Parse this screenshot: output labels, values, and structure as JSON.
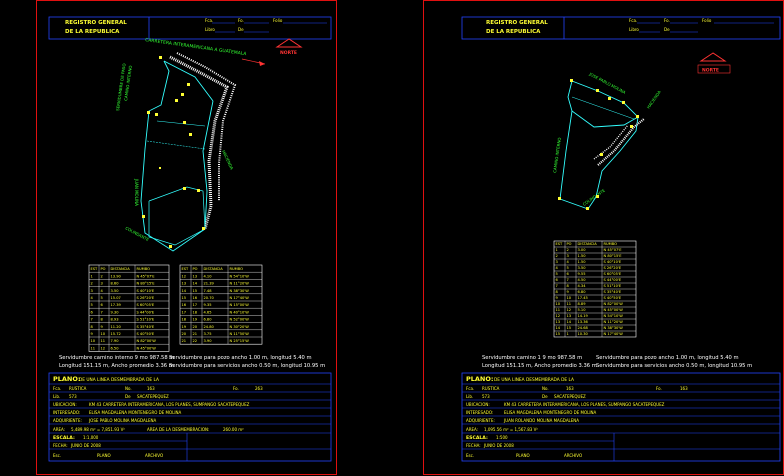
{
  "colors": {
    "background": "#000000",
    "border": "#e01010",
    "text": "#ffff33",
    "line": "#33ffff",
    "label": "#33ff33",
    "blue": "#2244ff",
    "white": "#ffffff"
  },
  "sheets": [
    {
      "header": {
        "title_line1": "REGISTRO GENERAL",
        "title_line2": "DE LA REPUBLICA",
        "finca_label": "Fca.",
        "folio_label": "Fo.",
        "libro_label": "Folio",
        "libro2_label": "Libro",
        "de_label": "De"
      },
      "north_label": "NORTE",
      "road_labels": [
        "CARRETERA INTERAMERICANA A GUATEMALA",
        "SERVIDUMBRE DE PASO",
        "CAMINO INTERNO",
        "JUAN MOLINA",
        "HACIENDA",
        "COLINDANTE"
      ],
      "table1": {
        "headers": [
          "EST",
          "PO",
          "DISTANCIA",
          "RUMBO"
        ],
        "rows": [
          [
            "1",
            "2",
            "13.90",
            "N 45°07'E"
          ],
          [
            "2",
            "3",
            "8.60",
            "N 80°15'E"
          ],
          [
            "3",
            "4",
            "3.50",
            "S 40°10'E"
          ],
          [
            "4",
            "5",
            "15.07",
            "S 26°20'E"
          ],
          [
            "5",
            "6",
            "17.39",
            "S 60°05'E"
          ],
          [
            "6",
            "7",
            "9.30",
            "S 44°00'E"
          ],
          [
            "7",
            "8",
            "8.93",
            "S 51°10'E"
          ],
          [
            "8",
            "9",
            "11.20",
            "S 35°40'E"
          ],
          [
            "9",
            "10",
            "15.72",
            "S 40°50'E"
          ],
          [
            "10",
            "11",
            "7.90",
            "N 82°00'W"
          ],
          [
            "11",
            "12",
            "6.50",
            "N 45°00'W"
          ]
        ]
      },
      "table2": {
        "headers": [
          "EST",
          "PO",
          "DISTANCIA",
          "RUMBO"
        ],
        "rows": [
          [
            "12",
            "13",
            "4.10",
            "N 54°10'W"
          ],
          [
            "13",
            "14",
            "21.39",
            "N 11°20'W"
          ],
          [
            "14",
            "15",
            "7.48",
            "N 38°30'W"
          ],
          [
            "15",
            "16",
            "20.70",
            "N 17°40'W"
          ],
          [
            "16",
            "17",
            "9.35",
            "N 15°00'W"
          ],
          [
            "17",
            "18",
            "4.65",
            "N 40°10'W"
          ],
          [
            "18",
            "19",
            "6.80",
            "N 52°00'W"
          ],
          [
            "19",
            "20",
            "24.80",
            "N 30°20'W"
          ],
          [
            "20",
            "21",
            "3.75",
            "N 11°50'W"
          ],
          [
            "21",
            "22",
            "3.90",
            "N 25°15'W"
          ]
        ]
      },
      "notes": [
        "Servidumbre camino interno 9 mo  987.58 m",
        "Servidumbre para pozo ancho 1.00 m, longitud 5.40 m",
        "Longitud 151.15 m, Ancho promedio 3.36 m",
        "Servidumbre para servicios ancho 0.50 m, longitud 10.95 m"
      ],
      "footer": {
        "plano_label": "PLANO:",
        "plano_value": "DE UNA LINEA DESMEMBRADA DE LA",
        "finca_label": "Fca.",
        "finca_value": "RUSTICA",
        "no_label": "No.",
        "no_value": "163",
        "folio_label": "Fo.",
        "folio_value": "263",
        "lib_label": "Lib.",
        "lib_value": "573",
        "de_label": "De",
        "de_value": "SACATEPEQUEZ",
        "ubicacion_label": "UBICACION:",
        "ubicacion_value": "KM 43 CARRETERA INTERAMERICANA, LOS PLANES, SUMPANGO SACATEPEQUEZ",
        "interesado_label": "INTERESADO:",
        "interesado_value": "ELISA MAGDALENA MONTENEGRO DE MOLINA",
        "adquiriente_label": "ADQUIRIENTE:",
        "adquiriente_value": "JOSE PABLO MOLINA MAGDALENA",
        "area_label": "AREA:",
        "area_value": "5,489.98 m² = 7,851.93 V²",
        "area_desm_label": "AREA DE LA DESMEMBRACION:",
        "area_desm_value": "260.00 m²",
        "escala_label": "ESCALA:",
        "escala_value": "1:1,000",
        "fecha_label": "FECHA:",
        "fecha_value": "JUNIO DE 2008",
        "esc_label": "Esc.",
        "planos_label": "PLANO",
        "archivo_label": "ARCHIVO"
      }
    },
    {
      "header": {
        "title_line1": "REGISTRO GENERAL",
        "title_line2": "DE LA REPUBLICA",
        "finca_label": "Fca.",
        "folio_label": "Fo.",
        "libro_label": "Folio",
        "libro2_label": "Libro",
        "de_label": "De"
      },
      "north_label": "NORTE",
      "road_labels": [
        "JOSE PABLO MOLINA",
        "HACIENDA",
        "CAMINO INTERNO",
        "COLINDANTE"
      ],
      "table1": {
        "headers": [
          "EST",
          "PO",
          "DISTANCIA",
          "RUMBO"
        ],
        "rows": [
          [
            "1",
            "2",
            "3.00",
            "N 45°07'E"
          ],
          [
            "2",
            "3",
            "1.50",
            "N 80°15'E"
          ],
          [
            "3",
            "4",
            "1.50",
            "S 40°10'E"
          ],
          [
            "4",
            "5",
            "3.50",
            "S 26°20'E"
          ],
          [
            "5",
            "6",
            "9.55",
            "S 60°05'E"
          ],
          [
            "6",
            "7",
            "4.50",
            "S 44°00'E"
          ],
          [
            "7",
            "8",
            "4.34",
            "S 51°10'E"
          ],
          [
            "8",
            "9",
            "6.80",
            "S 35°40'E"
          ],
          [
            "9",
            "10",
            "17.45",
            "S 40°50'E"
          ],
          [
            "10",
            "11",
            "8.89",
            "N 82°00'W"
          ],
          [
            "11",
            "12",
            "5.10",
            "N 45°00'W"
          ],
          [
            "12",
            "13",
            "14.19",
            "N 54°10'W"
          ],
          [
            "13",
            "14",
            "13.36",
            "N 11°20'W"
          ],
          [
            "14",
            "15",
            "24.68",
            "N 38°30'W"
          ],
          [
            "15",
            "1",
            "10.30",
            "N 17°40'W"
          ]
        ]
      },
      "notes": [
        "Servidumbre camino 1 9 mo  987.58 m",
        "Servidumbre para pozo ancho 1.00 m, longitud 5.40 m",
        "Longitud 151.15 m, Ancho promedio 3.36 m",
        "Servidumbre para servicios ancho 0.50 m, longitud 10.95 m"
      ],
      "footer": {
        "plano_label": "PLANO:",
        "plano_value": "DE UNA LINEA DESMEMBRADA DE LA",
        "finca_label": "Fca.",
        "finca_value": "RUSTICA",
        "no_label": "No.",
        "no_value": "163",
        "folio_label": "Fo.",
        "folio_value": "163",
        "lib_label": "Lib.",
        "lib_value": "573",
        "de_label": "De",
        "de_value": "SACATEPEQUEZ",
        "ubicacion_label": "UBICACION:",
        "ubicacion_value": "KM 43 CARRETERA INTERAMERICANA, LOS PLANES, SUMPANGO SACATEPEQUEZ",
        "interesado_label": "INTERESADO:",
        "interesado_value": "ELISA MAGDALENA MONTENEGRO DE MOLINA",
        "adquiriente_label": "ADQUIRIENTE:",
        "adquiriente_value": "JUAN ROLANDO MOLINA MAGDALENA",
        "area_label": "AREA:",
        "area_value": "1,095.56 m² = 1,567.83 V²",
        "area_desm_label": "",
        "area_desm_value": "",
        "escala_label": "ESCALA:",
        "escala_value": "1:500",
        "fecha_label": "FECHA:",
        "fecha_value": "JUNIO DE 2008",
        "esc_label": "Esc.",
        "planos_label": "PLANO",
        "archivo_label": "ARCHIVO"
      }
    }
  ]
}
